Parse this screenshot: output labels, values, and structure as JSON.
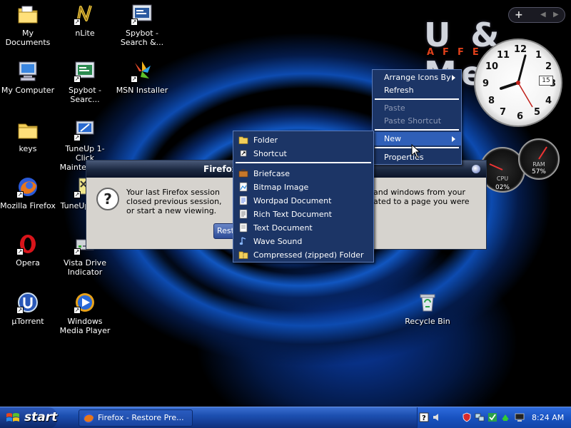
{
  "desktop_icons": [
    {
      "id": "my-documents",
      "label": "My Documents",
      "icon": "folder-documents-icon"
    },
    {
      "id": "nlite",
      "label": "nLite",
      "icon": "nlite-icon"
    },
    {
      "id": "spybot-1",
      "label": "Spybot - Search &...",
      "icon": "spybot-icon"
    },
    {
      "id": "my-computer",
      "label": "My Computer",
      "icon": "computer-icon"
    },
    {
      "id": "spybot-2",
      "label": "Spybot - Searc...",
      "icon": "spybot-icon"
    },
    {
      "id": "msn-installer",
      "label": "MSN Installer",
      "icon": "msn-icon"
    },
    {
      "id": "keys",
      "label": "keys",
      "icon": "folder-icon"
    },
    {
      "id": "tuneup-1click",
      "label": "TuneUp 1-Click Maintenance",
      "icon": "tuneup-icon"
    },
    {
      "id": "mozilla-firefox",
      "label": "Mozilla Firefox",
      "icon": "firefox-icon"
    },
    {
      "id": "tuneup-2",
      "label": "TuneUp 20...",
      "icon": "tuneup-icon"
    },
    {
      "id": "opera",
      "label": "Opera",
      "icon": "opera-icon"
    },
    {
      "id": "vista-drive",
      "label": "Vista Drive Indicator",
      "icon": "drive-indicator-icon"
    },
    {
      "id": "utorrent",
      "label": "µTorrent",
      "icon": "utorrent-icon"
    },
    {
      "id": "windows-media-player",
      "label": "Windows Media Player",
      "icon": "media-player-icon"
    },
    {
      "id": "recycle-bin",
      "label": "Recycle Bin",
      "icon": "recycle-bin-icon"
    }
  ],
  "wallpaper_logo": {
    "text": "U & Me",
    "sub": "AFFE"
  },
  "clock_gadget": {
    "numbers": [
      "12",
      "1",
      "2",
      "3",
      "4",
      "5",
      "6",
      "7",
      "8",
      "9",
      "10",
      "11"
    ],
    "date": "15"
  },
  "gauges": {
    "cpu_label": "CPU",
    "cpu_value": "02%",
    "ram_label": "RAM",
    "ram_value": "57%"
  },
  "gadget_bar": {
    "add": "+",
    "prev": "◀",
    "next": "▶"
  },
  "dialog": {
    "title": "Firefox",
    "message_left": "Your last Firefox session closed previous session, or start a new viewing.",
    "message_right": "and windows from your ated to a page you were",
    "restore_button": "Restore"
  },
  "context_menu": {
    "items": [
      {
        "label": "Arrange Icons By",
        "submenu": true,
        "enabled": true
      },
      {
        "label": "Refresh",
        "submenu": false,
        "enabled": true
      },
      {
        "label": "Paste",
        "submenu": false,
        "enabled": false
      },
      {
        "label": "Paste Shortcut",
        "submenu": false,
        "enabled": false
      },
      {
        "label": "New",
        "submenu": true,
        "enabled": true
      },
      {
        "label": "Properties",
        "submenu": false,
        "enabled": true
      }
    ]
  },
  "new_submenu": {
    "items": [
      {
        "label": "Folder",
        "icon": "folder-icon"
      },
      {
        "label": "Shortcut",
        "icon": "shortcut-icon"
      },
      {
        "label": "Briefcase",
        "icon": "briefcase-icon"
      },
      {
        "label": "Bitmap Image",
        "icon": "bitmap-icon"
      },
      {
        "label": "Wordpad Document",
        "icon": "wordpad-icon"
      },
      {
        "label": "Rich Text Document",
        "icon": "rich-text-icon"
      },
      {
        "label": "Text Document",
        "icon": "text-document-icon"
      },
      {
        "label": "Wave Sound",
        "icon": "wave-sound-icon"
      },
      {
        "label": "Compressed (zipped) Folder",
        "icon": "zip-folder-icon"
      }
    ]
  },
  "taskbar": {
    "start_label": "start",
    "tasks": [
      {
        "label": "Firefox - Restore Pre..."
      }
    ],
    "clock": "8:24 AM"
  },
  "colors": {
    "menu_bg": "#1c3566",
    "menu_highlight": "#2f5fb8",
    "taskbar_blue": "#1c4fb0",
    "wallpaper_blue": "#1156c0"
  }
}
